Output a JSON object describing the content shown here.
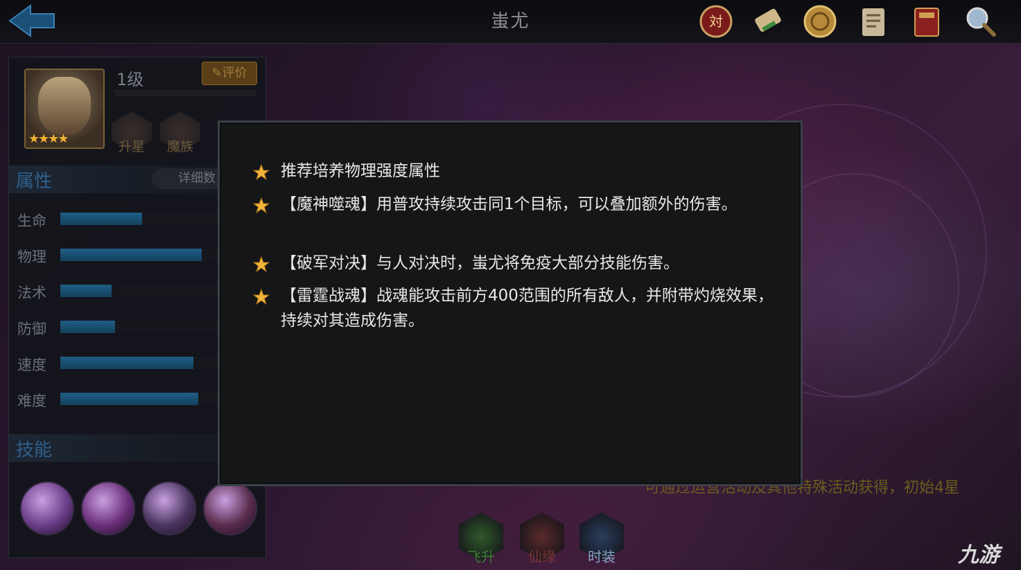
{
  "header": {
    "title": "蚩尤",
    "icons": [
      "battle-medal-icon",
      "scroll-icon",
      "coin-icon",
      "document-icon",
      "book-icon",
      "magnifier-icon"
    ]
  },
  "hero_panel": {
    "level": "1级",
    "rate_label": "评价",
    "stars": "★★★★",
    "badges": [
      "升星",
      "魔族"
    ],
    "attributes_title": "属性",
    "detail_label": "详细数",
    "stats": [
      {
        "label": "生命",
        "value": 0.49
      },
      {
        "label": "物理",
        "value": 0.85
      },
      {
        "label": "法术",
        "value": 0.31
      },
      {
        "label": "防御",
        "value": 0.33
      },
      {
        "label": "速度",
        "value": 0.8
      },
      {
        "label": "难度",
        "value": 0.83
      }
    ],
    "skills_title": "技能",
    "skill_colors": [
      "#6a3d8a",
      "#6b2f7a",
      "#4a3560",
      "#5a2c4e"
    ]
  },
  "tips_dialog": {
    "tips": [
      "推荐培养物理强度属性",
      "【魔神噬魂】用普攻持续攻击同1个目标，可以叠加额外的伤害。",
      "【破军对决】与人对决时，蚩尤将免疫大部分技能伤害。",
      "【雷霆战魂】战魂能攻击前方400范围的所有敌人，并附带灼烧效果，持续对其造成伤害。"
    ]
  },
  "bottom": {
    "note": "可通过运营活动及其他特殊活动获得，初始4星",
    "tabs": [
      {
        "label": "飞升",
        "color": "#2f5a2a"
      },
      {
        "label": "仙缘",
        "color": "#5a2a2a"
      },
      {
        "label": "时装",
        "color": "#2a3f5e"
      }
    ]
  },
  "watermark": "九游"
}
